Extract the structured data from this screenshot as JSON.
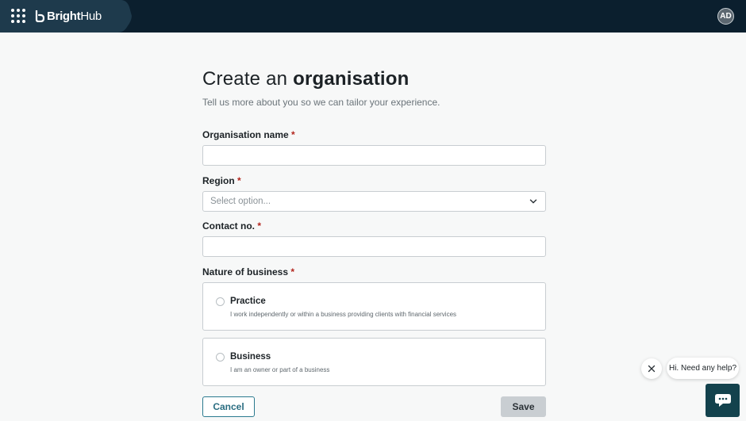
{
  "header": {
    "brand_bold": "Bright",
    "brand_regular": "Hub",
    "avatar_initials": "AD"
  },
  "form": {
    "title_prefix": "Create an",
    "title_emphasis": "organisation",
    "subtitle": "Tell us more about you so we can tailor your experience.",
    "required_marker": "*",
    "fields": {
      "organisation_name": {
        "label": "Organisation name",
        "value": ""
      },
      "region": {
        "label": "Region",
        "placeholder": "Select option..."
      },
      "contact_no": {
        "label": "Contact no.",
        "value": ""
      },
      "nature_of_business": {
        "label": "Nature of business",
        "options": [
          {
            "title": "Practice",
            "description": "I work independently or within a business providing clients with financial services",
            "selected": false
          },
          {
            "title": "Business",
            "description": "I am an owner or part of a business",
            "selected": false
          }
        ]
      }
    },
    "cancel_label": "Cancel",
    "save_label": "Save"
  },
  "chat": {
    "prompt": "Hi. Need any help?"
  },
  "colors": {
    "header_bg": "#0b1f2e",
    "brand_tab": "#1e3a4c",
    "accent": "#2b7a8f",
    "required": "#b3261e",
    "chat_launcher": "#13424d"
  },
  "icons": [
    "apps-grid-icon",
    "brand-logo-icon",
    "chevron-down-icon",
    "close-icon",
    "chat-icon"
  ]
}
